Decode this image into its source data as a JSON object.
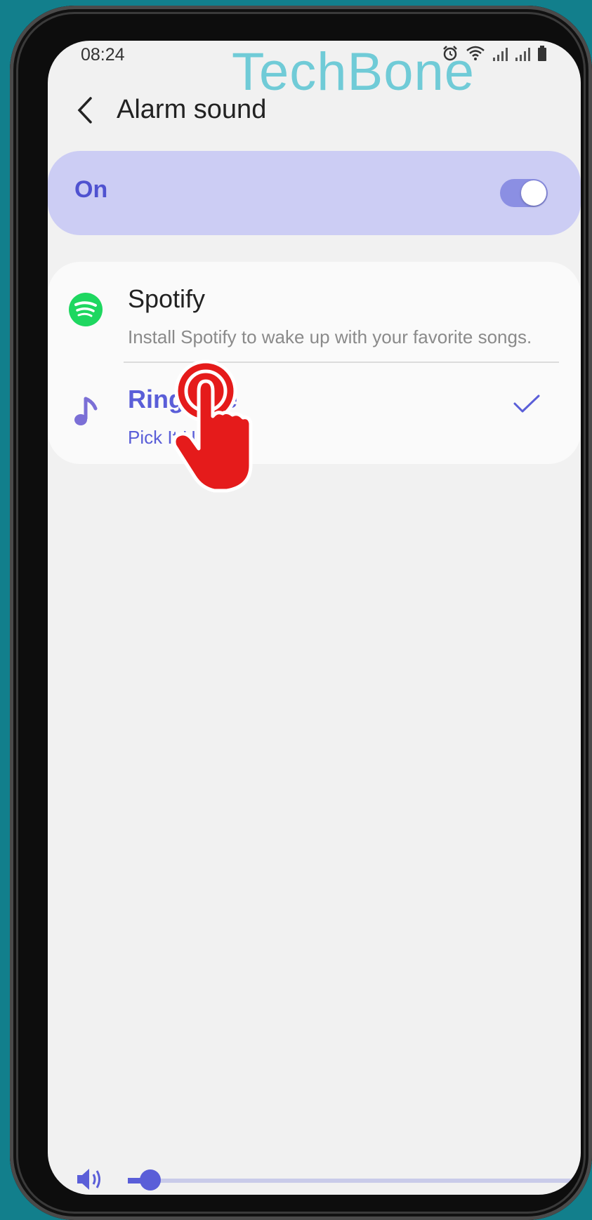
{
  "status_bar": {
    "time": "08:24"
  },
  "watermark": "TechBone",
  "header": {
    "title": "Alarm sound"
  },
  "alarm_toggle": {
    "label": "On",
    "enabled": true
  },
  "options": [
    {
      "title": "Spotify",
      "subtitle": "Install Spotify to wake up with your favorite songs.",
      "selected": false
    },
    {
      "title": "Ringtone",
      "subtitle": "Pick It Up",
      "selected": true
    }
  ],
  "volume": {
    "level": 0.05
  },
  "colors": {
    "accent": "#5a5ed8",
    "toggle_card_bg": "#cccdf4",
    "spotify": "#1ed760",
    "background": "#f1f1f1",
    "frame_bg": "#127f8c"
  }
}
